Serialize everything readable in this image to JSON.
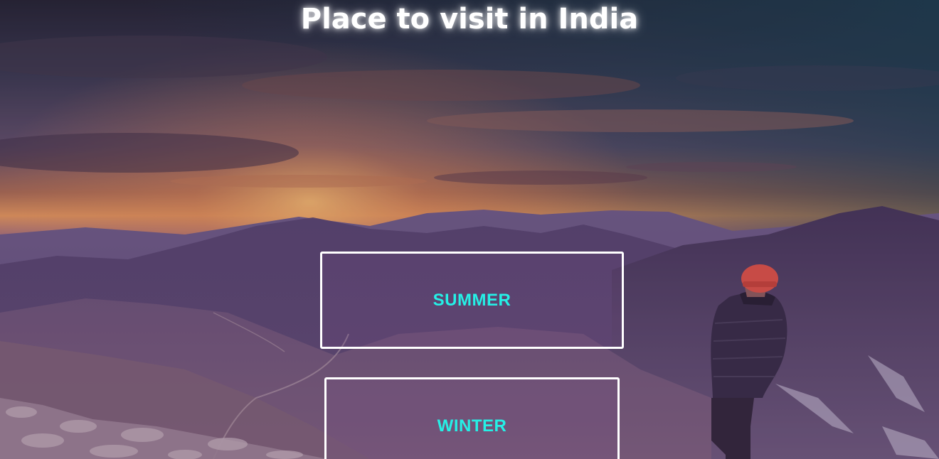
{
  "page": {
    "title": "Place to visit in India"
  },
  "buttons": {
    "summer_label": "SUMMER",
    "winter_label": "WINTER"
  },
  "colors": {
    "title_text": "#ffffff",
    "button_text": "#25f0e6",
    "button_border": "#ffffff",
    "overlay_tint": "#6a4a78"
  },
  "background": {
    "description_icon": "mountain-sunset-hiker-image"
  }
}
